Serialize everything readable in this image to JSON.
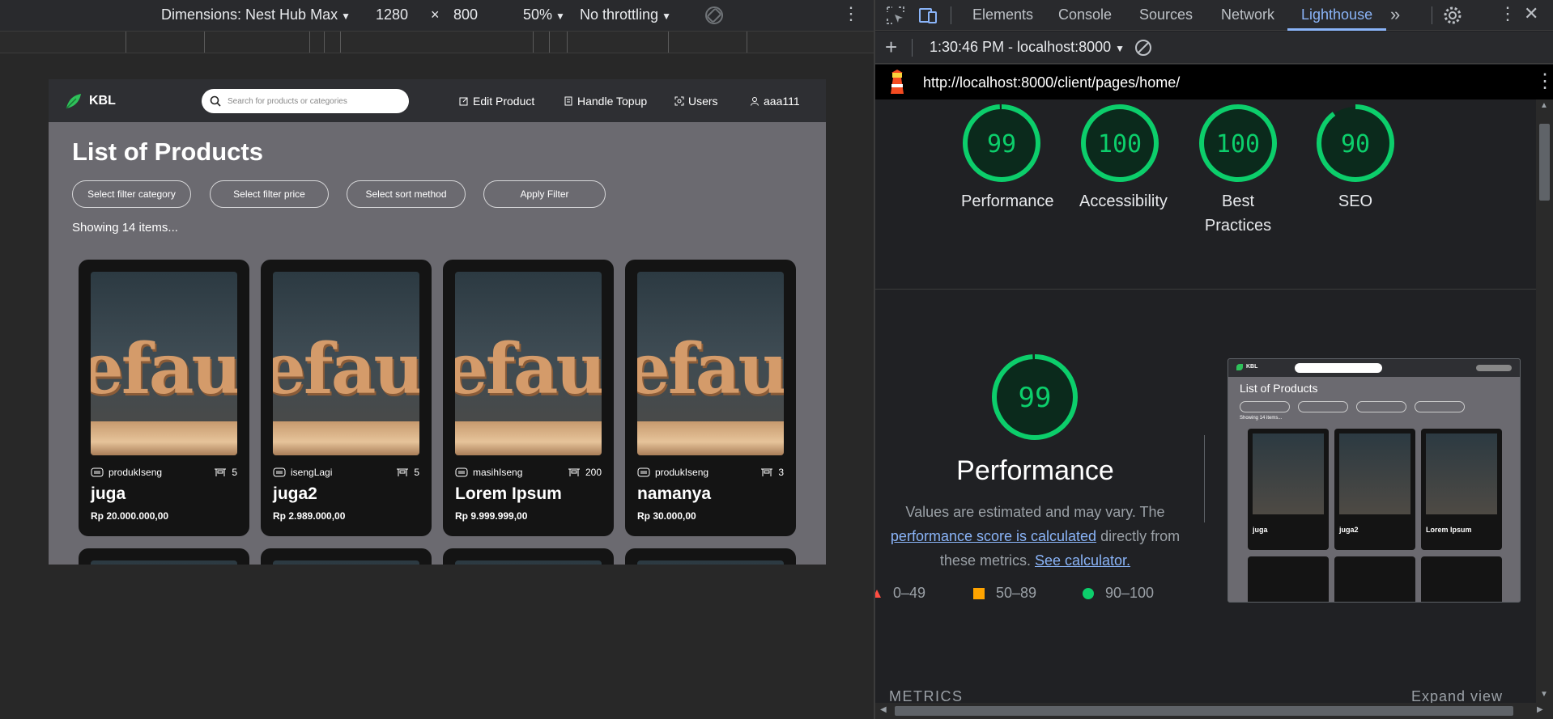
{
  "device_toolbar": {
    "dimensions_label": "Dimensions: Nest Hub Max",
    "width": "1280",
    "times": "×",
    "height": "800",
    "zoom": "50%",
    "throttling": "No throttling"
  },
  "site": {
    "brand": "KBL",
    "search_placeholder": "Search for products or categories",
    "nav": {
      "edit_product": "Edit Product",
      "handle_topup": "Handle Topup",
      "users": "Users",
      "account": "aaa111"
    },
    "page_title": "List of Products",
    "filters": {
      "category": "Select filter category",
      "price": "Select filter price",
      "sort": "Select sort method",
      "apply": "Apply Filter"
    },
    "showing_text": "Showing 14 items...",
    "image_word": "efau",
    "products": [
      {
        "category": "produkIseng",
        "stock": "5",
        "name": "juga",
        "price": "Rp 20.000.000,00"
      },
      {
        "category": "isengLagi",
        "stock": "5",
        "name": "juga2",
        "price": "Rp 2.989.000,00"
      },
      {
        "category": "masihIseng",
        "stock": "200",
        "name": "Lorem Ipsum",
        "price": "Rp 9.999.999,00"
      },
      {
        "category": "produkIseng",
        "stock": "3",
        "name": "namanya",
        "price": "Rp 30.000,00"
      }
    ]
  },
  "devtools": {
    "tabs": [
      "Elements",
      "Console",
      "Sources",
      "Network",
      "Lighthouse"
    ],
    "active_tab": "Lighthouse",
    "report_selector": "1:30:46 PM - localhost:8000",
    "url": "http://localhost:8000/client/pages/home/",
    "scores": [
      {
        "label": "Performance",
        "score": "99"
      },
      {
        "label": "Accessibility",
        "score": "100"
      },
      {
        "label": "Best Practices",
        "score": "100"
      },
      {
        "label": "SEO",
        "score": "90"
      }
    ],
    "perf_score": "99",
    "perf_title": "Performance",
    "perf_desc_pre": "Values are estimated and may vary. The",
    "perf_desc_link": "performance score is calculated",
    "perf_desc_mid": "directly from these metrics.",
    "perf_desc_calc": "See calculator.",
    "legend": [
      "0–49",
      "50–89",
      "90–100"
    ],
    "metrics_label": "METRICS",
    "expand_view": "Expand view",
    "colors": {
      "pass": "#0cce6b",
      "average": "#ffa400",
      "fail": "#ff4e42",
      "accent": "#8ab4f8"
    }
  }
}
